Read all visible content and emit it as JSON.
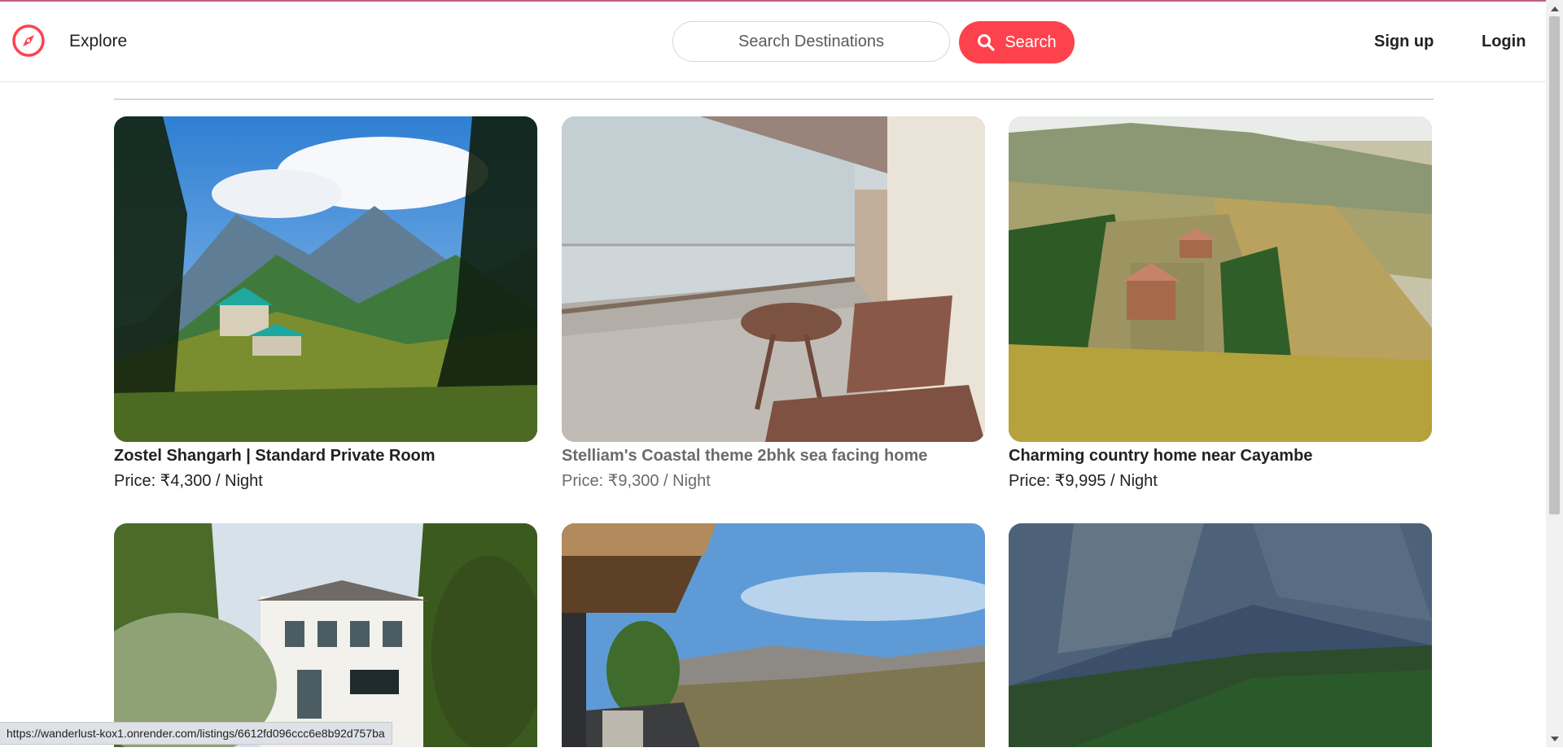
{
  "nav": {
    "explore_label": "Explore",
    "search_placeholder": "Search Destinations",
    "search_button_label": "Search",
    "signup_label": "Sign up",
    "login_label": "Login",
    "icons": {
      "brand": "compass-icon",
      "search": "search-icon"
    },
    "accent_color": "#fe424d"
  },
  "listings": [
    {
      "title": "Zostel Shangarh | Standard Private Room",
      "price": "Price: ₹4,300 / Night"
    },
    {
      "title": "Stelliam's Coastal theme 2bhk sea facing home",
      "price": "Price: ₹9,300 / Night"
    },
    {
      "title": "Charming country home near Cayambe",
      "price": "Price: ₹9,995 / Night"
    },
    {
      "title": "",
      "price": ""
    },
    {
      "title": "",
      "price": ""
    },
    {
      "title": "",
      "price": ""
    }
  ],
  "status_bar": {
    "url": "https://wanderlust-kox1.onrender.com/listings/6612fd096ccc6e8b92d757ba"
  }
}
